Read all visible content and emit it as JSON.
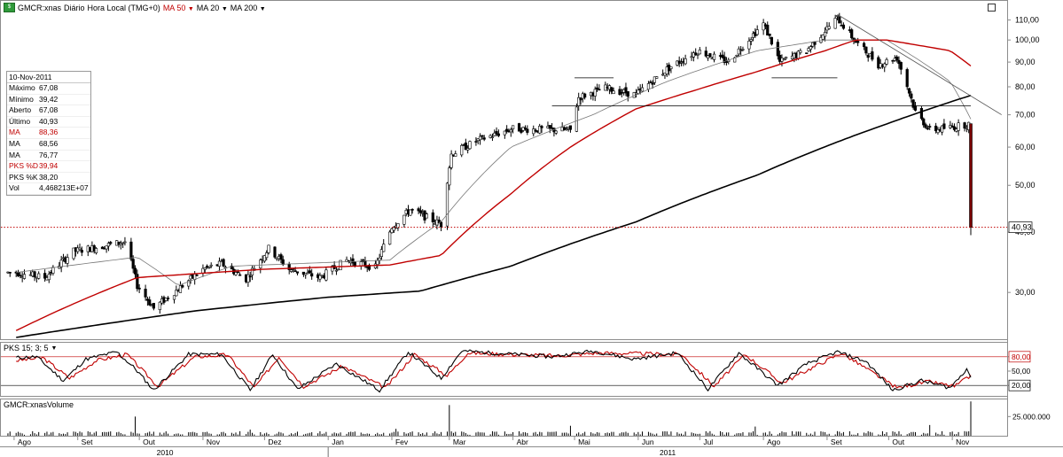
{
  "header": {
    "symbol": "GMCR:xnas",
    "period": "Diário",
    "timezone": "Hora Local (TMG+0)",
    "ma_labels": [
      "MA 50",
      "MA 20",
      "MA 200"
    ],
    "ma_colors": [
      "#c00000",
      "#000000",
      "#000000"
    ]
  },
  "info_panel": {
    "date": "10-Nov-2011",
    "rows": [
      {
        "label": "Máximo",
        "value": "67,08",
        "color": "#000000"
      },
      {
        "label": "Mínimo",
        "value": "39,42",
        "color": "#000000"
      },
      {
        "label": "Aberto",
        "value": "67,08",
        "color": "#000000"
      },
      {
        "label": "Último",
        "value": "40,93",
        "color": "#000000"
      },
      {
        "label": "MA",
        "value": "88,36",
        "color": "#c00000"
      },
      {
        "label": "MA",
        "value": "68,56",
        "color": "#000000"
      },
      {
        "label": "MA",
        "value": "76,77",
        "color": "#000000"
      },
      {
        "label": "PKS %D",
        "value": "39,94",
        "color": "#c00000"
      },
      {
        "label": "PKS %K",
        "value": "38,20",
        "color": "#000000"
      },
      {
        "label": "Vol",
        "value": "4,468213E+07",
        "color": "#000000"
      }
    ]
  },
  "stoch_header": "PKS 15; 3; 5",
  "volume_header": "GMCR:xnasVolume",
  "icons": {
    "app_icon": "chart-app-icon",
    "dropdown_arrow": "dropdown-arrow-icon",
    "maximize": "maximize-icon"
  },
  "colors": {
    "price_up": "#ffffff",
    "price_down": "#000000",
    "ma50": "#c00000",
    "ma20": "#777777",
    "ma200": "#000000",
    "stoch_k": "#000000",
    "stoch_d": "#c00000",
    "last_price_line": "#c00000"
  },
  "chart_data": [
    {
      "type": "candlestick",
      "title": "GMCR:xnas Diário Hora Local (TMG+0)",
      "yscale": "log",
      "ylim": [
        24,
        120
      ],
      "y_ticks": [
        30,
        40,
        50,
        60,
        70,
        80,
        90,
        100,
        110
      ],
      "y_tick_labels": [
        "30,00",
        "40,00",
        "50,00",
        "60,00",
        "70,00",
        "80,00",
        "90,00",
        "100,00",
        "110,00"
      ],
      "last_price": 40.93,
      "last_price_label": "40,93",
      "x_months": [
        "Ago",
        "Set",
        "Out",
        "Nov",
        "Dez",
        "Jan",
        "Fev",
        "Mar",
        "Abr",
        "Mai",
        "Jun",
        "Jul",
        "Ago",
        "Set",
        "Out",
        "Nov"
      ],
      "x_years": [
        "2010",
        "2011"
      ],
      "price_path": [
        [
          "2010-08-02",
          33.0
        ],
        [
          "2010-08-16",
          32.2
        ],
        [
          "2010-08-30",
          36.5
        ],
        [
          "2010-09-10",
          37.2
        ],
        [
          "2010-09-24",
          38.2
        ],
        [
          "2010-09-30",
          31.0
        ],
        [
          "2010-10-08",
          27.8
        ],
        [
          "2010-10-20",
          30.5
        ],
        [
          "2010-11-01",
          33.5
        ],
        [
          "2010-11-10",
          34.4
        ],
        [
          "2010-11-22",
          32.0
        ],
        [
          "2010-12-03",
          37.0
        ],
        [
          "2010-12-13",
          33.5
        ],
        [
          "2010-12-28",
          32.2
        ],
        [
          "2011-01-10",
          35.0
        ],
        [
          "2011-01-24",
          33.8
        ],
        [
          "2011-02-01",
          41.0
        ],
        [
          "2011-02-10",
          44.5
        ],
        [
          "2011-02-25",
          41.5
        ],
        [
          "2011-03-02",
          58.0
        ],
        [
          "2011-03-15",
          62.0
        ],
        [
          "2011-04-01",
          65.5
        ],
        [
          "2011-04-29",
          65.0
        ],
        [
          "2011-05-03",
          76.0
        ],
        [
          "2011-05-16",
          79.5
        ],
        [
          "2011-05-31",
          77.0
        ],
        [
          "2011-06-15",
          87.0
        ],
        [
          "2011-06-30",
          95.0
        ],
        [
          "2011-07-15",
          90.0
        ],
        [
          "2011-08-01",
          108.0
        ],
        [
          "2011-08-09",
          90.0
        ],
        [
          "2011-08-22",
          95.0
        ],
        [
          "2011-09-06",
          111.0
        ],
        [
          "2011-09-15",
          99.0
        ],
        [
          "2011-09-26",
          89.0
        ],
        [
          "2011-10-05",
          92.0
        ],
        [
          "2011-10-14",
          71.0
        ],
        [
          "2011-10-21",
          65.0
        ],
        [
          "2011-11-01",
          66.0
        ],
        [
          "2011-11-09",
          67.0
        ],
        [
          "2011-11-10",
          40.93
        ]
      ],
      "ma50": [
        [
          "2010-08-02",
          25.0
        ],
        [
          "2010-09-30",
          32.2
        ],
        [
          "2010-11-30",
          33.5
        ],
        [
          "2011-01-31",
          34.2
        ],
        [
          "2011-02-25",
          35.8
        ],
        [
          "2011-03-31",
          48.0
        ],
        [
          "2011-04-29",
          60.0
        ],
        [
          "2011-05-31",
          72.0
        ],
        [
          "2011-06-30",
          79.0
        ],
        [
          "2011-07-29",
          86.0
        ],
        [
          "2011-08-31",
          95.0
        ],
        [
          "2011-09-15",
          100.0
        ],
        [
          "2011-09-30",
          100.0
        ],
        [
          "2011-10-31",
          95.0
        ],
        [
          "2011-11-10",
          88.36
        ]
      ],
      "ma20": [
        [
          "2010-08-02",
          33.0
        ],
        [
          "2010-09-30",
          35.5
        ],
        [
          "2010-10-20",
          31.0
        ],
        [
          "2010-11-15",
          34.0
        ],
        [
          "2011-01-31",
          35.0
        ],
        [
          "2011-02-25",
          42.0
        ],
        [
          "2011-03-31",
          60.0
        ],
        [
          "2011-05-10",
          70.0
        ],
        [
          "2011-06-15",
          82.0
        ],
        [
          "2011-07-29",
          95.0
        ],
        [
          "2011-08-31",
          100.0
        ],
        [
          "2011-09-30",
          100.0
        ],
        [
          "2011-10-31",
          82.0
        ],
        [
          "2011-11-10",
          68.56
        ]
      ],
      "ma200": [
        [
          "2010-08-02",
          24.2
        ],
        [
          "2010-10-29",
          27.5
        ],
        [
          "2010-12-31",
          29.3
        ],
        [
          "2011-02-15",
          30.2
        ],
        [
          "2011-03-31",
          34.0
        ],
        [
          "2011-05-31",
          42.0
        ],
        [
          "2011-07-29",
          52.5
        ],
        [
          "2011-09-30",
          67.0
        ],
        [
          "2011-11-10",
          76.77
        ]
      ],
      "annotations": [
        {
          "type": "hline",
          "y": 83.5,
          "from": "2011-05-01",
          "to": "2011-05-20"
        },
        {
          "type": "hline",
          "y": 83.5,
          "from": "2011-08-05",
          "to": "2011-09-06"
        },
        {
          "type": "hline",
          "y": 73.0,
          "from": "2011-04-20",
          "to": "2011-11-10"
        },
        {
          "type": "trendline",
          "from": [
            "2011-09-06",
            113.0
          ],
          "to": [
            "2011-11-25",
            70.0
          ]
        }
      ]
    },
    {
      "type": "line",
      "title": "PKS 15; 3; 5",
      "ylim": [
        0,
        100
      ],
      "y_ticks": [
        20,
        50,
        80
      ],
      "y_tick_labels": [
        "20,00",
        "50,00",
        "80,00"
      ],
      "series": [
        {
          "name": "PKS %K",
          "values": [
            [
              "2010-08-02",
              78
            ],
            [
              "2010-08-12",
              80
            ],
            [
              "2010-08-25",
              30
            ],
            [
              "2010-09-05",
              75
            ],
            [
              "2010-09-20",
              90
            ],
            [
              "2010-09-29",
              55
            ],
            [
              "2010-10-08",
              10
            ],
            [
              "2010-10-25",
              85
            ],
            [
              "2010-11-10",
              85
            ],
            [
              "2010-11-24",
              10
            ],
            [
              "2010-12-05",
              85
            ],
            [
              "2010-12-17",
              12
            ],
            [
              "2011-01-05",
              65
            ],
            [
              "2011-01-26",
              10
            ],
            [
              "2011-02-09",
              90
            ],
            [
              "2011-02-25",
              35
            ],
            [
              "2011-03-07",
              92
            ],
            [
              "2011-04-20",
              80
            ],
            [
              "2011-05-10",
              92
            ],
            [
              "2011-05-30",
              75
            ],
            [
              "2011-06-20",
              88
            ],
            [
              "2011-07-05",
              12
            ],
            [
              "2011-07-20",
              88
            ],
            [
              "2011-08-08",
              20
            ],
            [
              "2011-08-22",
              65
            ],
            [
              "2011-09-06",
              90
            ],
            [
              "2011-09-20",
              70
            ],
            [
              "2011-10-03",
              10
            ],
            [
              "2011-10-17",
              30
            ],
            [
              "2011-10-31",
              15
            ],
            [
              "2011-11-08",
              55
            ],
            [
              "2011-11-10",
              38.2
            ]
          ]
        },
        {
          "name": "PKS %D",
          "values": [
            [
              "2010-08-02",
              72
            ],
            [
              "2010-08-15",
              78
            ],
            [
              "2010-08-28",
              35
            ],
            [
              "2010-09-10",
              72
            ],
            [
              "2010-09-25",
              85
            ],
            [
              "2010-10-10",
              18
            ],
            [
              "2010-10-28",
              80
            ],
            [
              "2010-11-13",
              84
            ],
            [
              "2010-11-26",
              15
            ],
            [
              "2010-12-08",
              80
            ],
            [
              "2010-12-20",
              18
            ],
            [
              "2011-01-08",
              60
            ],
            [
              "2011-01-29",
              15
            ],
            [
              "2011-02-12",
              85
            ],
            [
              "2011-02-28",
              40
            ],
            [
              "2011-03-10",
              88
            ],
            [
              "2011-04-23",
              82
            ],
            [
              "2011-05-12",
              88
            ],
            [
              "2011-06-22",
              85
            ],
            [
              "2011-07-08",
              18
            ],
            [
              "2011-07-23",
              85
            ],
            [
              "2011-08-10",
              25
            ],
            [
              "2011-09-08",
              88
            ],
            [
              "2011-10-05",
              15
            ],
            [
              "2011-10-20",
              28
            ],
            [
              "2011-11-02",
              18
            ],
            [
              "2011-11-10",
              39.94
            ]
          ]
        }
      ]
    },
    {
      "type": "bar",
      "title": "GMCR:xnasVolume",
      "y_ticks": [
        25000000
      ],
      "y_tick_labels": [
        "25.000.000"
      ],
      "ylim": [
        0,
        45000000
      ],
      "last_value": 44682130,
      "bars": [
        [
          "2010-09-29",
          25000000
        ],
        [
          "2010-11-24",
          8000000
        ],
        [
          "2010-12-08",
          5000000
        ],
        [
          "2011-02-03",
          9000000
        ],
        [
          "2011-03-01",
          40000000
        ],
        [
          "2011-04-29",
          13000000
        ],
        [
          "2011-07-28",
          12000000
        ],
        [
          "2011-09-06",
          6000000
        ],
        [
          "2011-10-21",
          14000000
        ],
        [
          "2011-11-10",
          44682130
        ]
      ],
      "baseline_volume": 3000000
    }
  ]
}
